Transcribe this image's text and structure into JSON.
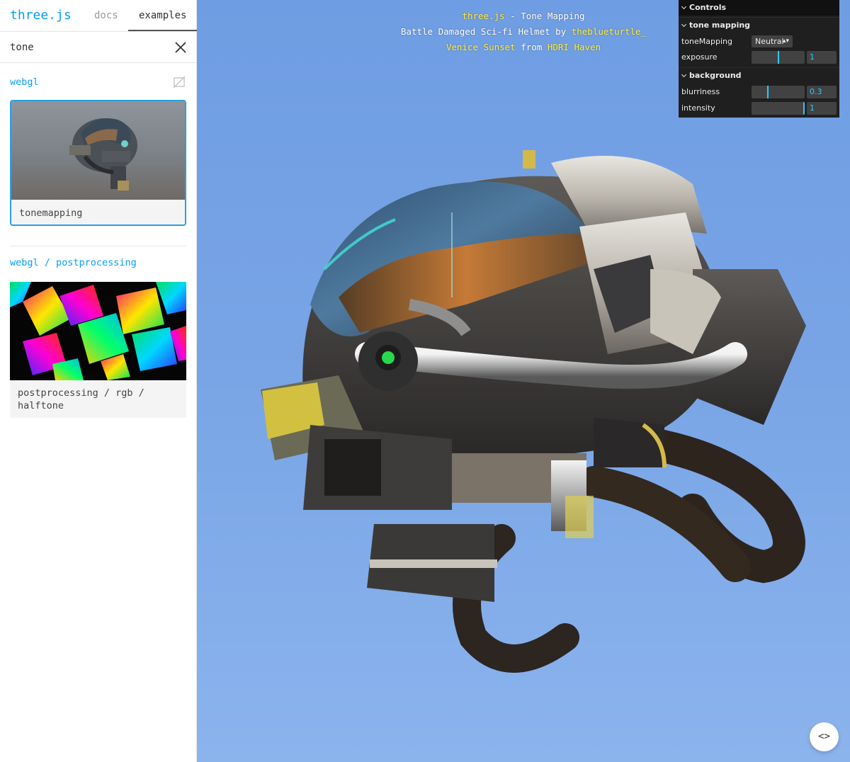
{
  "sidebar": {
    "logo": "three.js",
    "tabs": [
      "docs",
      "examples"
    ],
    "active_tab": "examples",
    "search": {
      "value": "tone",
      "placeholder": ""
    },
    "categories": [
      {
        "title": "webgl",
        "items": [
          {
            "label": "tonemapping",
            "selected": true
          }
        ]
      },
      {
        "title": "webgl / postprocessing",
        "items": [
          {
            "label": "postprocessing / rgb / halftone",
            "selected": false
          }
        ]
      }
    ]
  },
  "info": {
    "line1": {
      "link": "three.js",
      "text": " - Tone Mapping"
    },
    "line2": {
      "text": "Battle Damaged Sci-fi Helmet by ",
      "link": "theblueturtle_"
    },
    "line3": {
      "link1": "Venice Sunset",
      "mid": " from ",
      "link2": "HDRI Haven"
    }
  },
  "gui": {
    "title": "Controls",
    "folders": [
      {
        "title": "tone mapping",
        "controls": [
          {
            "name": "toneMapping",
            "type": "select",
            "value": "Neutral"
          },
          {
            "name": "exposure",
            "type": "slider",
            "value": "1",
            "fraction": 0.5
          }
        ]
      },
      {
        "title": "background",
        "controls": [
          {
            "name": "blurriness",
            "type": "slider",
            "value": "0.3",
            "fraction": 0.3
          },
          {
            "name": "intensity",
            "type": "slider",
            "value": "1",
            "fraction": 1.0
          }
        ]
      }
    ]
  },
  "code_button": {
    "label": "<>"
  },
  "colors": {
    "accent": "#049ef4",
    "gui_value": "#2cc9ff",
    "info_link": "#ffef3a",
    "sky_top": "#6f9de3",
    "sky_bottom": "#8bb4ed"
  }
}
